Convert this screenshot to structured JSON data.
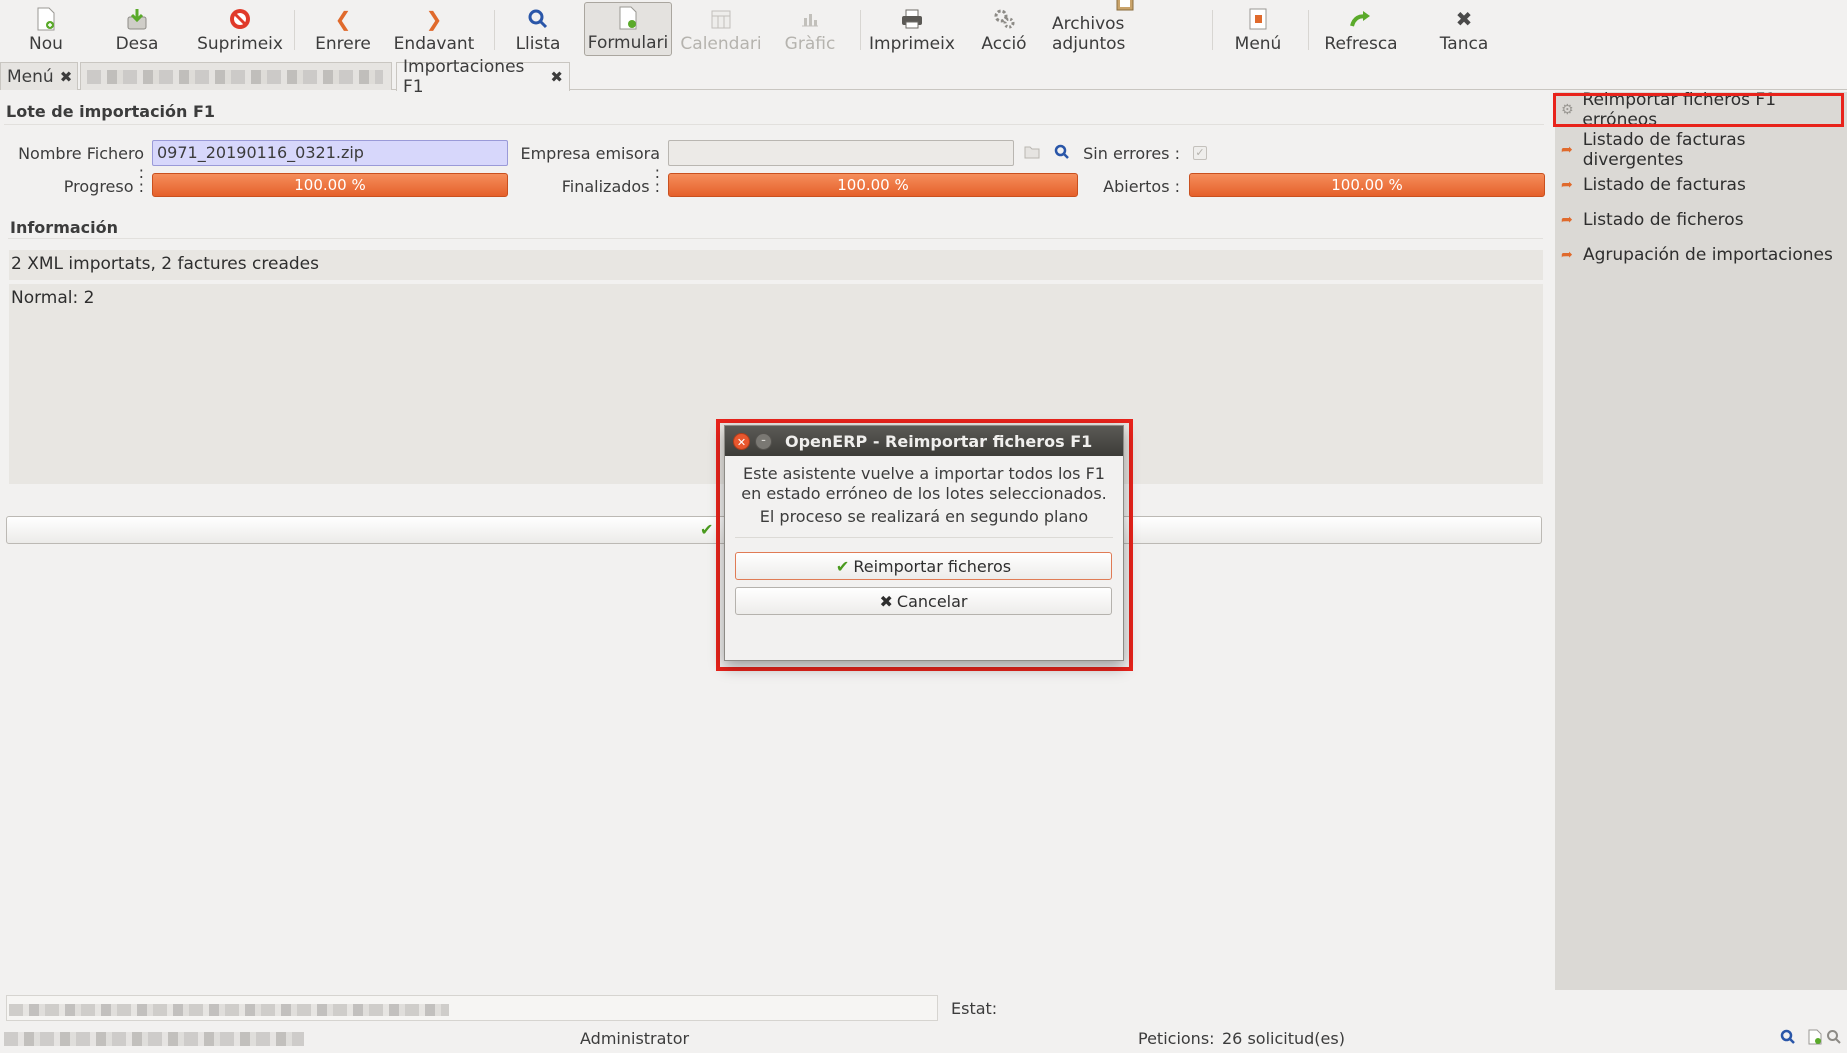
{
  "toolbar": {
    "new": "Nou",
    "save": "Desa",
    "delete": "Suprimeix",
    "previous": "Enrere",
    "next": "Endavant",
    "list": "Llista",
    "form": "Formulari",
    "calendar": "Calendari",
    "graph": "Gràfic",
    "print": "Imprimeix",
    "action": "Acció",
    "attachments": "Archivos adjuntos",
    "menu": "Menú",
    "refresh": "Refresca",
    "close": "Tanca"
  },
  "tabs": {
    "menu_label": "Menú",
    "current_label": "Importaciones F1",
    "close_glyph": "✖"
  },
  "form": {
    "title": "Lote de importación F1",
    "filename_label": "Nombre Fichero :",
    "filename_value": "0971_20190116_0321.zip",
    "company_label": "Empresa emisora :",
    "company_value": "",
    "no_errors_label": "Sin errores :",
    "progress_label": "Progreso :",
    "progress_text": "100.00 %",
    "progress_value": 100,
    "finished_label": "Finalizados :",
    "finished_text": "100.00 %",
    "finished_value": 100,
    "open_label": "Abiertos :",
    "open_text": "100.00 %",
    "open_value": 100,
    "info_heading": "Información",
    "info_summary": "2 XML importats, 2 factures creades",
    "info_detail": "Normal: 2"
  },
  "sidebar": {
    "items": [
      {
        "label": "Reimportar ficheros F1 erróneos"
      },
      {
        "label": "Listado de facturas divergentes"
      },
      {
        "label": "Listado de facturas"
      },
      {
        "label": "Listado de ficheros"
      },
      {
        "label": "Agrupación de importaciones"
      }
    ]
  },
  "statusbar": {
    "state_label": "Estat:",
    "user": "Administrator",
    "requests_label": "Peticions:",
    "requests_value": "26 solicitud(es)"
  },
  "dialog": {
    "title": "OpenERP - Reimportar ficheros F1",
    "line1": "Este asistente vuelve a importar todos los F1",
    "line2": "en estado erróneo de los lotes seleccionados.",
    "line3": "El proceso se realizará en segundo plano",
    "confirm_label": "Reimportar ficheros",
    "cancel_label": "Cancelar"
  },
  "colors": {
    "highlight": "#e8231b",
    "progress": "#e5602b",
    "required_field": "#d7d7fb"
  }
}
